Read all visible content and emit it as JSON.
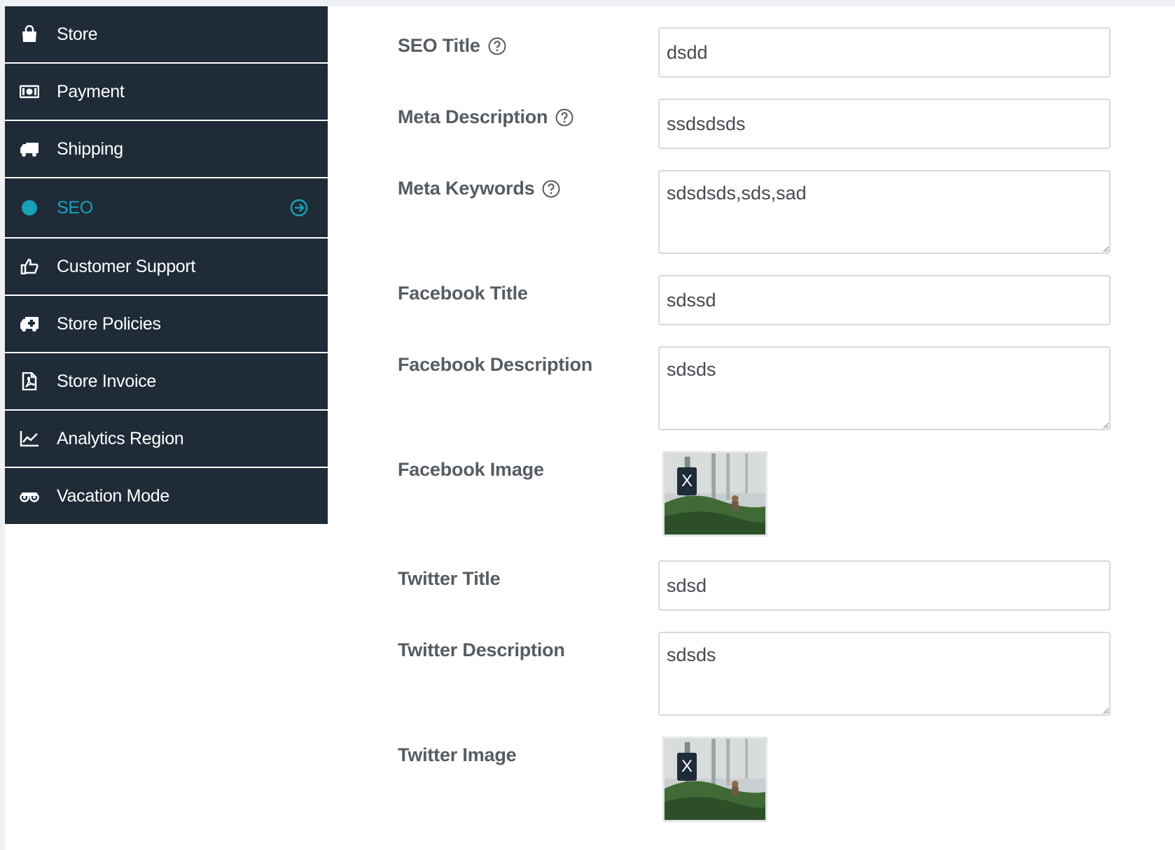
{
  "sidebar": {
    "items": [
      {
        "label": "Store",
        "icon": "shopping-bag-icon"
      },
      {
        "label": "Payment",
        "icon": "money-icon"
      },
      {
        "label": "Shipping",
        "icon": "truck-icon"
      },
      {
        "label": "SEO",
        "icon": "globe-icon",
        "active": true
      },
      {
        "label": "Customer Support",
        "icon": "thumbs-up-icon"
      },
      {
        "label": "Store Policies",
        "icon": "ambulance-icon"
      },
      {
        "label": "Store Invoice",
        "icon": "pdf-file-icon"
      },
      {
        "label": "Analytics Region",
        "icon": "line-chart-icon"
      },
      {
        "label": "Vacation Mode",
        "icon": "binoculars-icon"
      }
    ],
    "active_color": "#17a2b8",
    "background": "#1f2b37"
  },
  "form": {
    "seo_title": {
      "label": "SEO Title",
      "value": "dsdd"
    },
    "meta_description": {
      "label": "Meta Description",
      "value": "ssdsdsds"
    },
    "meta_keywords": {
      "label": "Meta Keywords",
      "value": "sdsdsds,sds,sad"
    },
    "facebook_title": {
      "label": "Facebook Title",
      "value": "sdssd"
    },
    "facebook_description": {
      "label": "Facebook Description",
      "value": "sdsds"
    },
    "facebook_image": {
      "label": "Facebook Image",
      "remove_label": "X"
    },
    "twitter_title": {
      "label": "Twitter Title",
      "value": "sdsd"
    },
    "twitter_description": {
      "label": "Twitter Description",
      "value": "sdsds"
    },
    "twitter_image": {
      "label": "Twitter Image",
      "remove_label": "X"
    }
  }
}
